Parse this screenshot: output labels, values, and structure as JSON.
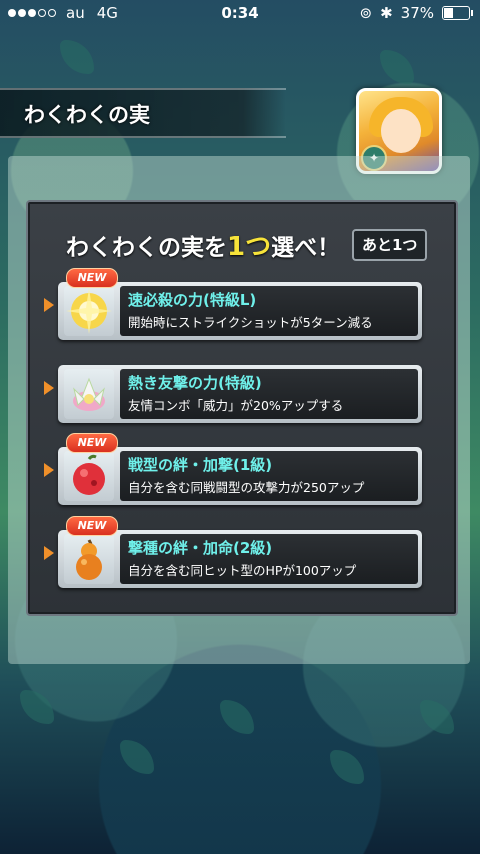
{
  "status_bar": {
    "carrier": "au",
    "network": "4G",
    "time": "0:34",
    "battery_percent": "37%",
    "battery_level": 0.37
  },
  "screen": {
    "title": "わくわくの実",
    "heading_prefix": "わくわくの実を",
    "heading_count": "1つ",
    "heading_suffix": "選べ！",
    "remaining_label": "あと1つ"
  },
  "options": [
    {
      "name": "速必殺の力(特級L)",
      "description": "開始時にストライクショットが5ターン減る",
      "new": true,
      "new_label": "NEW",
      "icon": "golden-sparkle-orb-icon"
    },
    {
      "name": "熱き友撃の力(特級)",
      "description": "友情コンボ「威力」が20%アップする",
      "new": false,
      "new_label": "",
      "icon": "lotus-fruit-icon"
    },
    {
      "name": "戦型の絆・加撃(1級)",
      "description": "自分を含む同戦闘型の攻撃力が250アップ",
      "new": true,
      "new_label": "NEW",
      "icon": "red-fruit-icon"
    },
    {
      "name": "撃種の絆・加命(2級)",
      "description": "自分を含む同ヒット型のHPが100アップ",
      "new": true,
      "new_label": "NEW",
      "icon": "gourd-fruit-icon"
    }
  ],
  "colors": {
    "accent_cyan": "#6ff0ea",
    "highlight_yellow": "#f7e33a",
    "new_red": "#d9301f",
    "arrow_orange": "#f0902a"
  }
}
